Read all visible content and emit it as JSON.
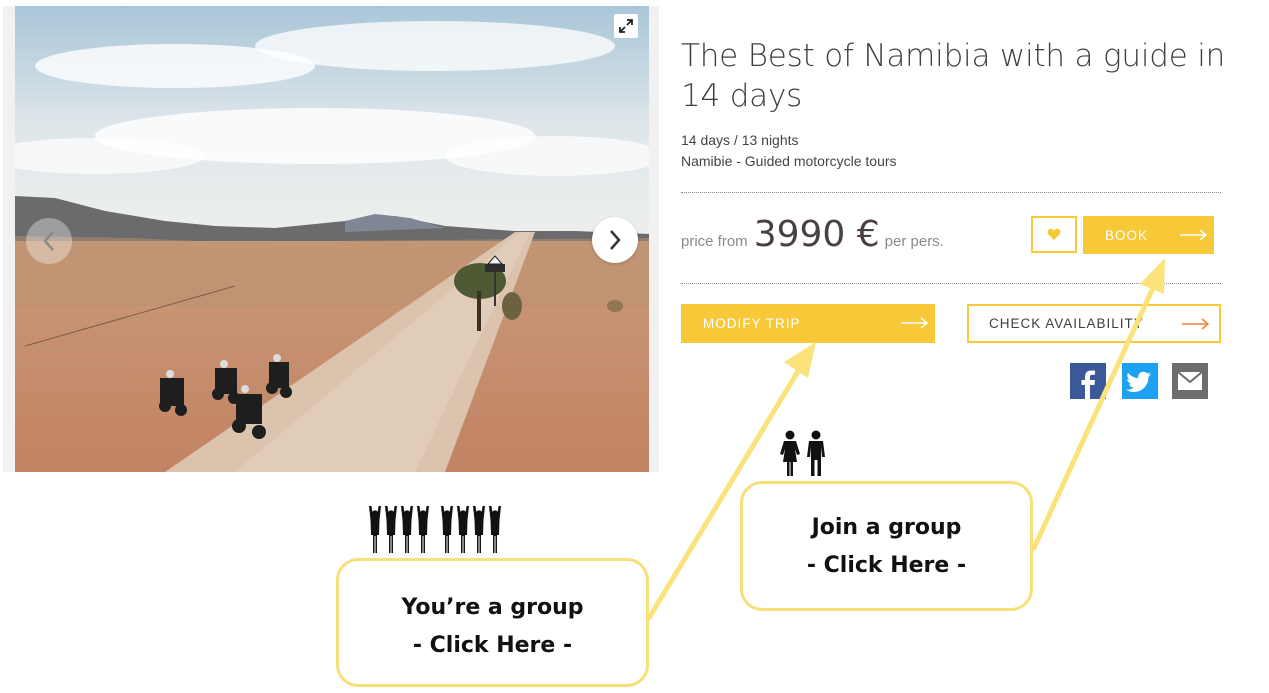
{
  "gallery": {
    "expand_icon": "expand-icon",
    "prev_icon": "chevron-left-icon",
    "next_icon": "chevron-right-icon"
  },
  "trip": {
    "title": "The Best of Namibia with a guide in 14 days",
    "duration": "14 days / 13 nights",
    "category": "Namibie - Guided motorcycle tours"
  },
  "pricing": {
    "prefix": "price from",
    "amount": "3990 €",
    "suffix": "per pers."
  },
  "actions": {
    "favorite_icon": "heart-icon",
    "book_label": "BOOK",
    "modify_label": "MODIFY TRIP",
    "availability_label": "CHECK AVAILABILITY",
    "arrow_icon": "arrow-right-icon"
  },
  "share": {
    "facebook": "facebook-icon",
    "twitter": "twitter-icon",
    "email": "email-icon"
  },
  "callouts": {
    "join_line1": "Join a group",
    "join_line2": "- Click Here -",
    "group_line1": "You’re a group",
    "group_line2": "- Click Here -"
  },
  "colors": {
    "accent": "#f7c837",
    "callout_border": "#f7e07a",
    "callout_arrow": "#fbe27a",
    "title_text": "#3f3f3f",
    "panel_bg": "#f1f1f1",
    "facebook": "#3b5998",
    "twitter": "#1da1f2",
    "email": "#6d6d6d"
  }
}
